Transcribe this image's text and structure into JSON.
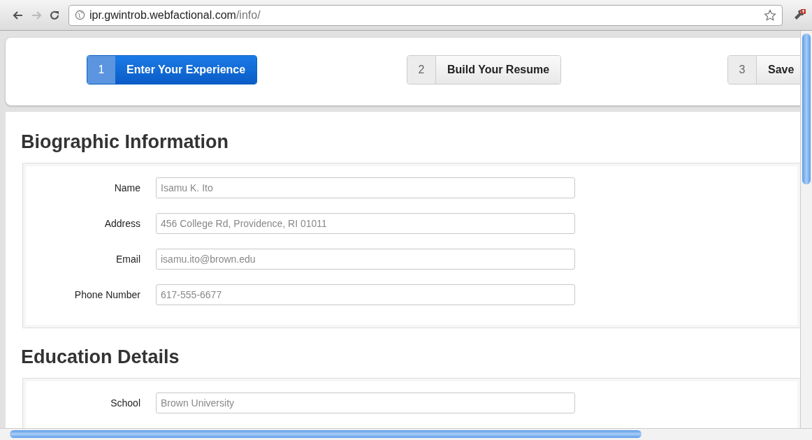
{
  "browser": {
    "url_host": "ipr.gwintrob.webfactional.com",
    "url_path": "/info/"
  },
  "steps": [
    {
      "number": "1",
      "label": "Enter Your Experience",
      "selected": true
    },
    {
      "number": "2",
      "label": "Build Your Resume",
      "selected": false
    },
    {
      "number": "3",
      "label": "Save",
      "selected": false
    }
  ],
  "sections": [
    {
      "title": "Biographic Information",
      "fields": [
        {
          "label": "Name",
          "placeholder": "Isamu K. Ito"
        },
        {
          "label": "Address",
          "placeholder": "456 College Rd, Providence, RI 01011"
        },
        {
          "label": "Email",
          "placeholder": "isamu.ito@brown.edu"
        },
        {
          "label": "Phone Number",
          "placeholder": "617-555-6677"
        }
      ]
    },
    {
      "title": "Education Details",
      "fields": [
        {
          "label": "School",
          "placeholder": "Brown University"
        }
      ]
    }
  ]
}
